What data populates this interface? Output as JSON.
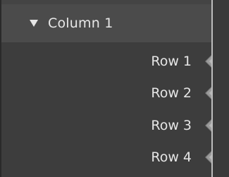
{
  "column": {
    "title": "Column 1",
    "expanded_icon": "triangle-down-icon"
  },
  "rows": [
    {
      "label": "Row 1",
      "icon": "diamond-socket-icon"
    },
    {
      "label": "Row 2",
      "icon": "diamond-socket-icon"
    },
    {
      "label": "Row 3",
      "icon": "diamond-socket-icon"
    },
    {
      "label": "Row 4",
      "icon": "diamond-socket-icon"
    }
  ]
}
